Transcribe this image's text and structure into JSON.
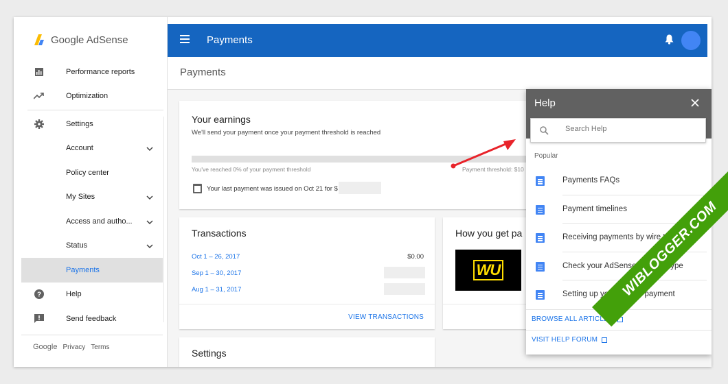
{
  "sidebar": {
    "logo_text": "Google AdSense",
    "items": [
      {
        "label": "Performance reports",
        "icon": "bar-chart-icon"
      },
      {
        "label": "Optimization",
        "icon": "trending-up-icon"
      },
      {
        "label": "Settings",
        "icon": "gear-icon"
      },
      {
        "label": "Account",
        "icon": "chevron-down-icon"
      },
      {
        "label": "Policy center",
        "icon": ""
      },
      {
        "label": "My Sites",
        "icon": "chevron-down-icon"
      },
      {
        "label": "Access and autho...",
        "icon": "chevron-down-icon"
      },
      {
        "label": "Status",
        "icon": "chevron-down-icon"
      },
      {
        "label": "Payments",
        "icon": "",
        "active": true
      },
      {
        "label": "Help",
        "icon": "help-circle-icon"
      },
      {
        "label": "Send feedback",
        "icon": "feedback-icon"
      }
    ],
    "footer": {
      "google": "Google",
      "privacy": "Privacy",
      "terms": "Terms"
    }
  },
  "topbar": {
    "title": "Payments"
  },
  "page": {
    "title": "Payments"
  },
  "earnings": {
    "title": "Your earnings",
    "subtitle": "We'll send your payment once your payment threshold is reached",
    "reached": "You've reached 0% of your payment threshold",
    "threshold": "Payment threshold: $10",
    "last_payment": "Your last payment was issued on Oct 21 for $",
    "progress_percent": 0
  },
  "transactions": {
    "title": "Transactions",
    "rows": [
      {
        "range": "Oct 1 – 26, 2017",
        "amount": "$0.00"
      },
      {
        "range": "Sep 1 – 30, 2017",
        "amount": ""
      },
      {
        "range": "Aug 1 – 31, 2017",
        "amount": ""
      }
    ],
    "link": "VIEW TRANSACTIONS"
  },
  "how": {
    "title": "How you get pa",
    "logo": "WU"
  },
  "settings_card": {
    "title": "Settings"
  },
  "help": {
    "title": "Help",
    "search_placeholder": "Search Help",
    "popular": "Popular",
    "articles": [
      "Payments FAQs",
      "Payment timelines",
      "Receiving payments by wire transfer",
      "Check your AdSense account type",
      "Setting up your form of payment"
    ],
    "browse": "BROWSE ALL ARTICLES",
    "forum": "VISIT HELP FORUM"
  },
  "watermark": "WIBLOGGER.COM",
  "colors": {
    "topbar": "#1565c0",
    "accent": "#1a73e8",
    "help_header": "#616161",
    "ribbon": "#43a00a",
    "arrow": "#e8232a"
  }
}
